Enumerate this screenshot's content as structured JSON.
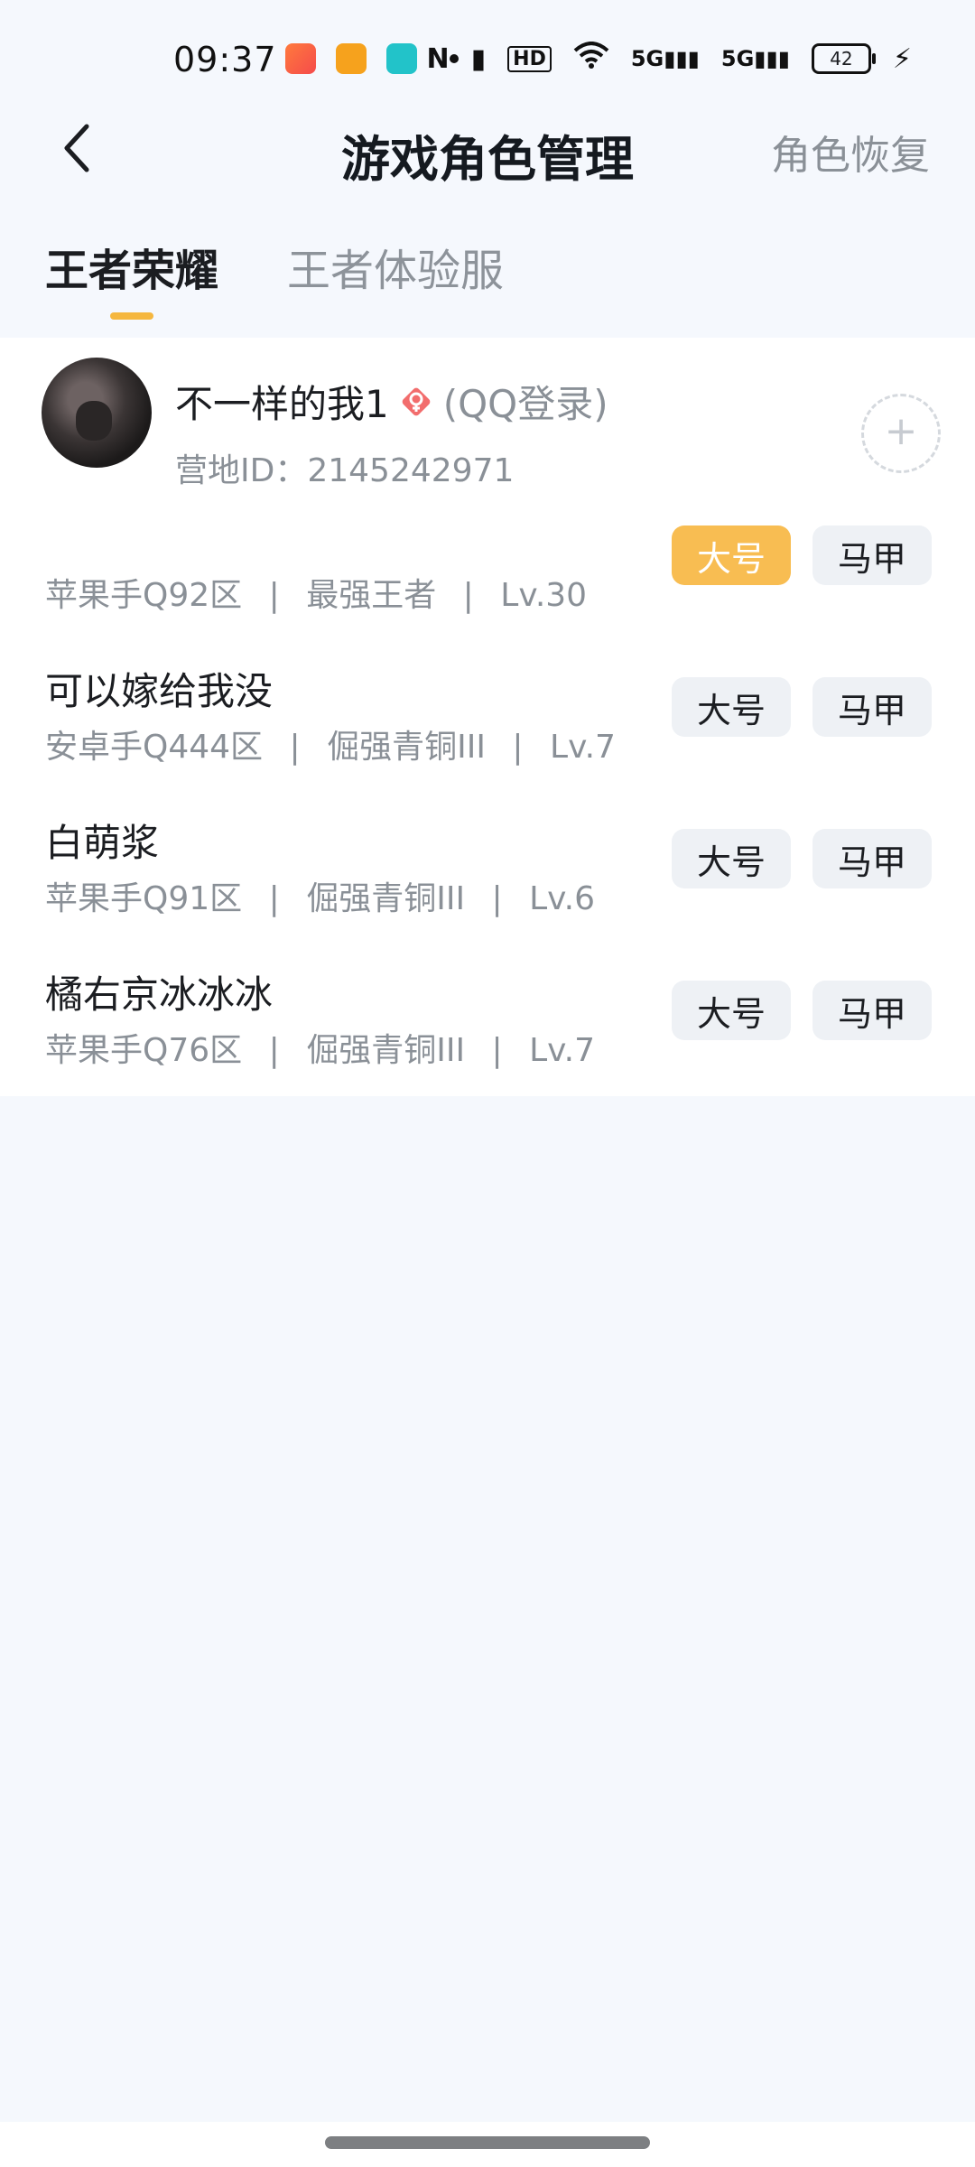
{
  "status_bar": {
    "time": "09:37",
    "battery": "42",
    "icons": [
      "game-app-icon",
      "orange-app-icon",
      "teal-app-icon",
      "nfc-icon",
      "vibrate-icon",
      "hd-icon",
      "wifi-icon",
      "5g-signal-icon",
      "5g-signal-icon",
      "charging-icon"
    ]
  },
  "header": {
    "title": "游戏角色管理",
    "action_label": "角色恢复"
  },
  "tabs": [
    {
      "label": "王者荣耀",
      "active": true
    },
    {
      "label": "王者体验服",
      "active": false
    }
  ],
  "account": {
    "name": "不一样的我1",
    "login": "(QQ登录)",
    "id_label": "营地ID：",
    "id_value": "2145242971"
  },
  "roles": [
    {
      "name": "  ",
      "server": "苹果手Q92区",
      "rank": "最强王者",
      "level": "Lv.30",
      "main_label": "大号",
      "alt_label": "马甲",
      "selected": "大号"
    },
    {
      "name": "可以嫁给我没",
      "server": "安卓手Q444区",
      "rank": "倔强青铜III",
      "level": "Lv.7",
      "main_label": "大号",
      "alt_label": "马甲",
      "selected": ""
    },
    {
      "name": "白萌浆",
      "server": "苹果手Q91区",
      "rank": "倔强青铜III",
      "level": "Lv.6",
      "main_label": "大号",
      "alt_label": "马甲",
      "selected": ""
    },
    {
      "name": "橘右京冰冰冰",
      "server": "苹果手Q76区",
      "rank": "倔强青铜III",
      "level": "Lv.7",
      "main_label": "大号",
      "alt_label": "马甲",
      "selected": ""
    }
  ],
  "meta_separator": "|",
  "colors": {
    "accent": "#f8bd52",
    "tab_underline": "#f5b73f",
    "background": "#f5f8fd",
    "muted_text": "#8a9097"
  }
}
